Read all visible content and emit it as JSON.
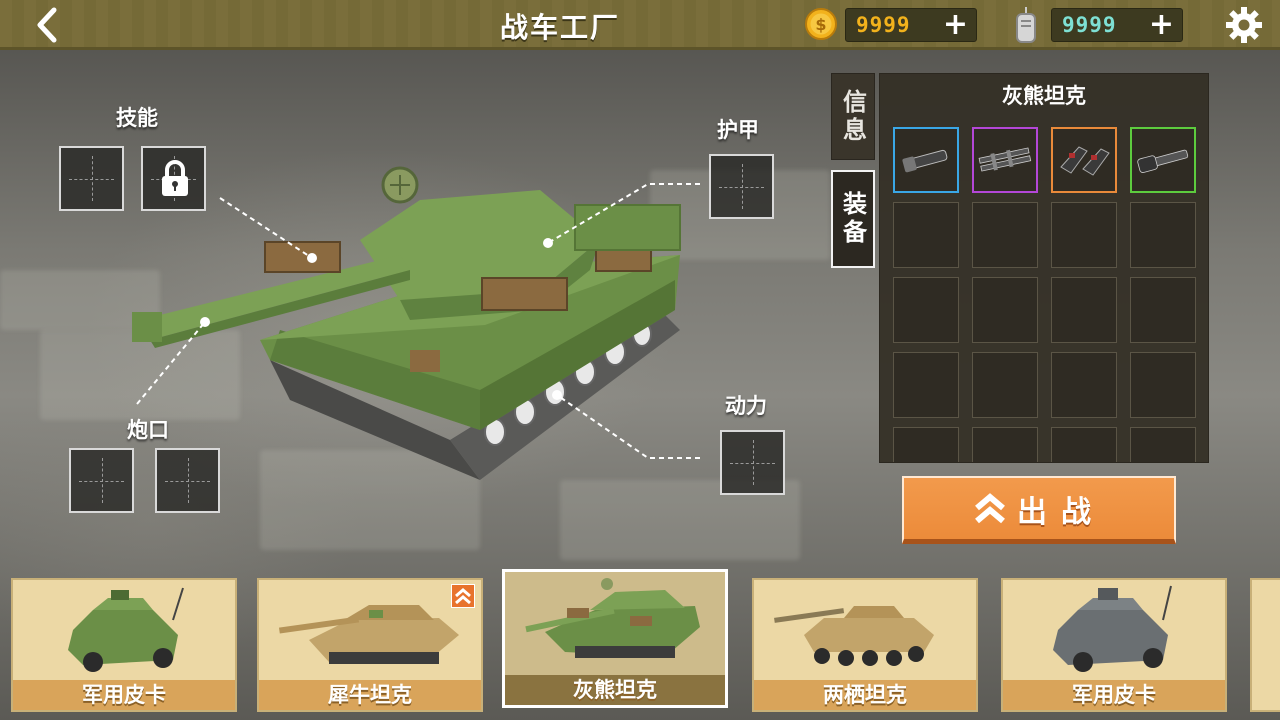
{
  "header": {
    "title": "战车工厂",
    "coins": "9999",
    "dogtags": "9999",
    "coin_symbol": "$"
  },
  "slots": {
    "skill_label": "技能",
    "armor_label": "护甲",
    "muzzle_label": "炮口",
    "power_label": "动力"
  },
  "panel": {
    "tab_info": "信息",
    "tab_equip": "装备",
    "title": "灰熊坦克",
    "equipped": [
      {
        "icon": "barrel-item-icon",
        "rarity": "blue"
      },
      {
        "icon": "double-barrel-item-icon",
        "rarity": "purple"
      },
      {
        "icon": "armor-plate-item-icon",
        "rarity": "orange"
      },
      {
        "icon": "cannon-item-icon",
        "rarity": "green"
      }
    ]
  },
  "battle_button": {
    "label": "出战"
  },
  "vehicles": [
    {
      "name": "军用皮卡",
      "selected": false
    },
    {
      "name": "犀牛坦克",
      "selected": false,
      "upgrade": true
    },
    {
      "name": "灰熊坦克",
      "selected": true
    },
    {
      "name": "两栖坦克",
      "selected": false
    },
    {
      "name": "军用皮卡",
      "selected": false
    }
  ],
  "colors": {
    "accent_orange": "#ec8b3a",
    "tank_green": "#6b8f47",
    "coin_gold": "#f2b21c",
    "dogtag_cyan": "#7ee0d4"
  }
}
